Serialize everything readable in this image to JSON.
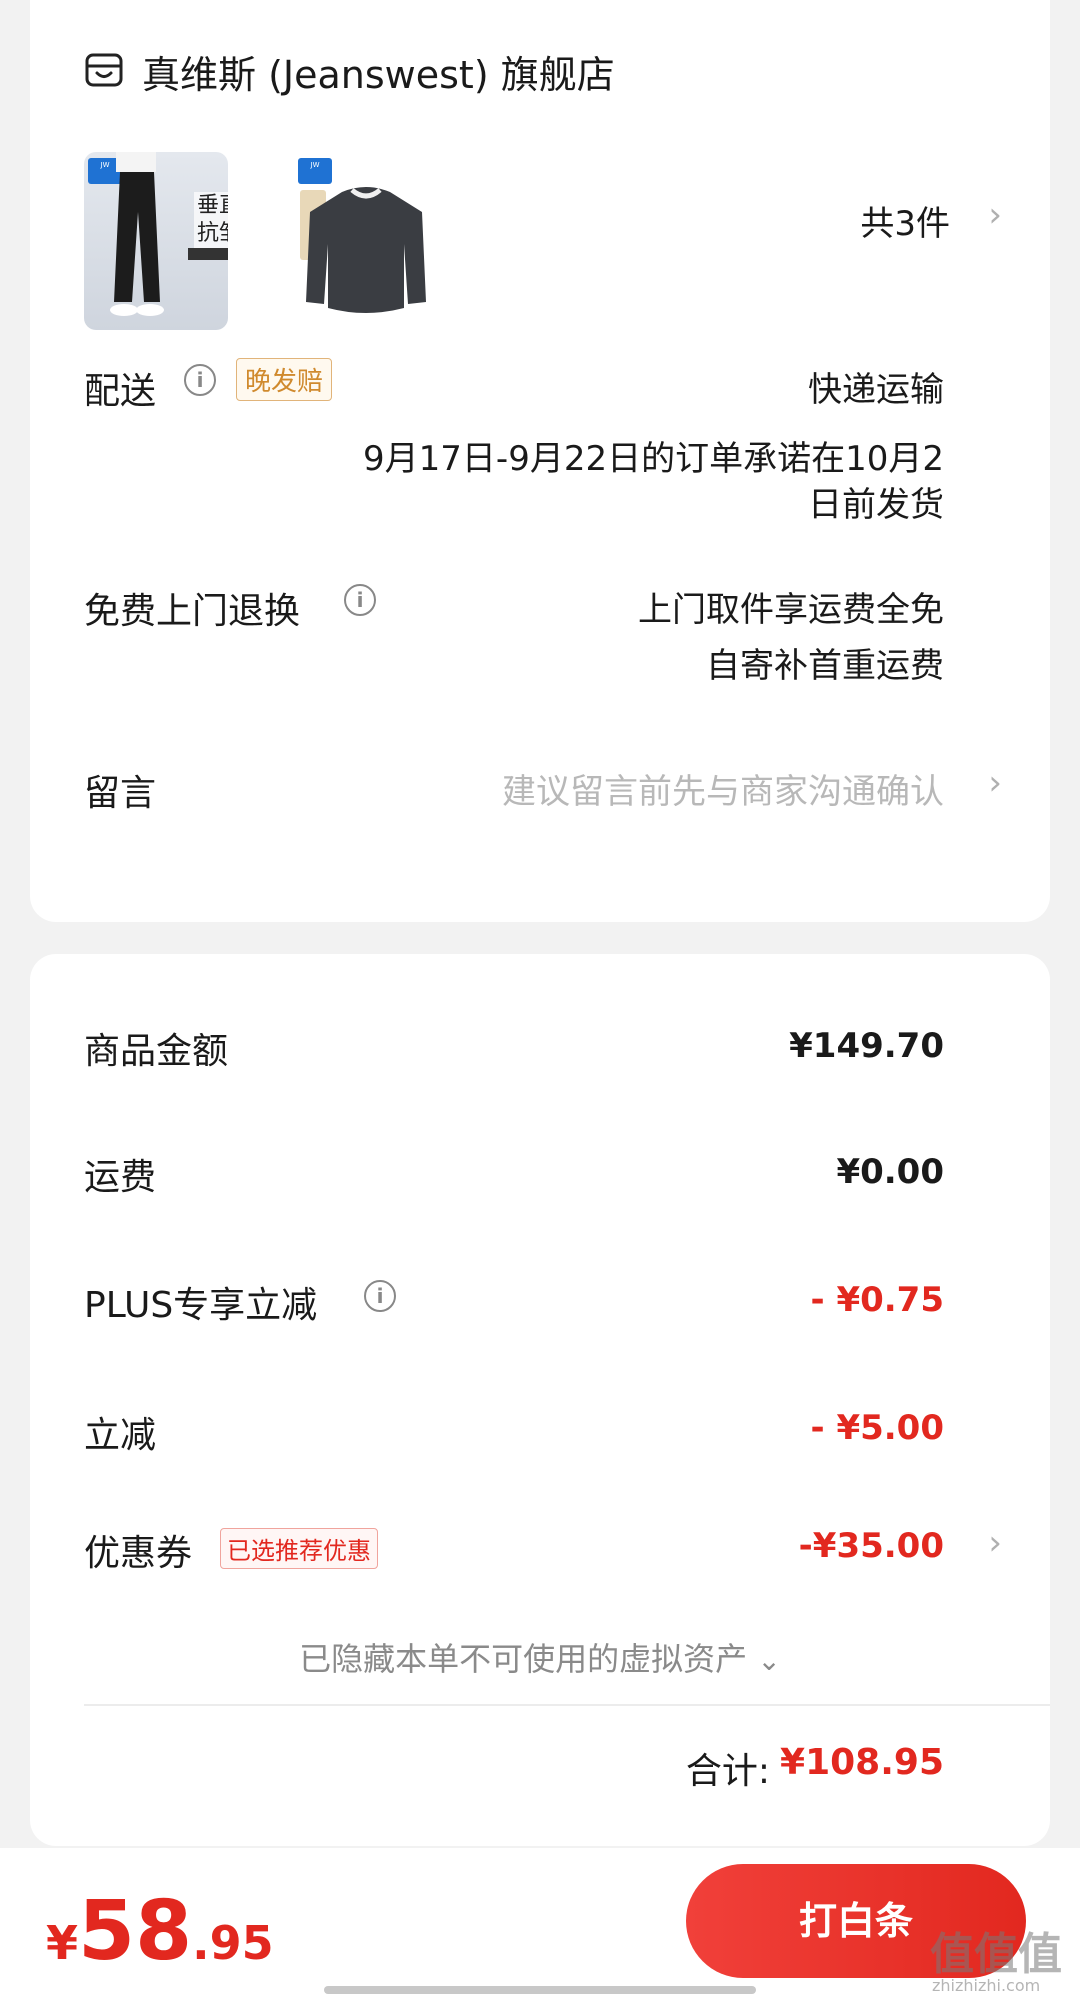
{
  "store": {
    "icon": "store-icon",
    "name": "真维斯 (Jeanswest) 旗舰店",
    "products": [
      {
        "icon": "pants-thumbnail",
        "labels": [
          "垂直",
          "抗皱"
        ]
      },
      {
        "icon": "sweater-thumbnail"
      }
    ],
    "item_count": "共3件"
  },
  "delivery": {
    "label": "配送",
    "badge": "晚发赔",
    "method": "快递运输",
    "promise": "9月17日-9月22日的订单承诺在10月2日前发货"
  },
  "return_service": {
    "label": "免费上门退换",
    "line1": "上门取件享运费全免",
    "line2": "自寄补首重运费"
  },
  "message": {
    "label": "留言",
    "placeholder": "建议留言前先与商家沟通确认"
  },
  "pricing": {
    "goods": {
      "label": "商品金额",
      "value": "¥149.70"
    },
    "shipping": {
      "label": "运费",
      "value": "¥0.00"
    },
    "plus": {
      "label": "PLUS专享立减",
      "value": "- ¥0.75"
    },
    "discount": {
      "label": "立减",
      "value": "- ¥5.00"
    },
    "coupon": {
      "label": "优惠券",
      "badge": "已选推荐优惠",
      "value": "-¥35.00"
    },
    "hidden_assets": "已隐藏本单不可使用的虚拟资产",
    "total_label": "合计:",
    "total_value": "¥108.95"
  },
  "footer": {
    "pay_currency": "¥",
    "pay_int": "58",
    "pay_dec": ".95",
    "pay_button": "打白条",
    "watermark": "值值值",
    "watermark_sub": "zhizhizhi.com"
  },
  "colors": {
    "accent_red": "#e2281f",
    "badge_orange": "#d08a2e",
    "background": "#f2f2f2"
  }
}
